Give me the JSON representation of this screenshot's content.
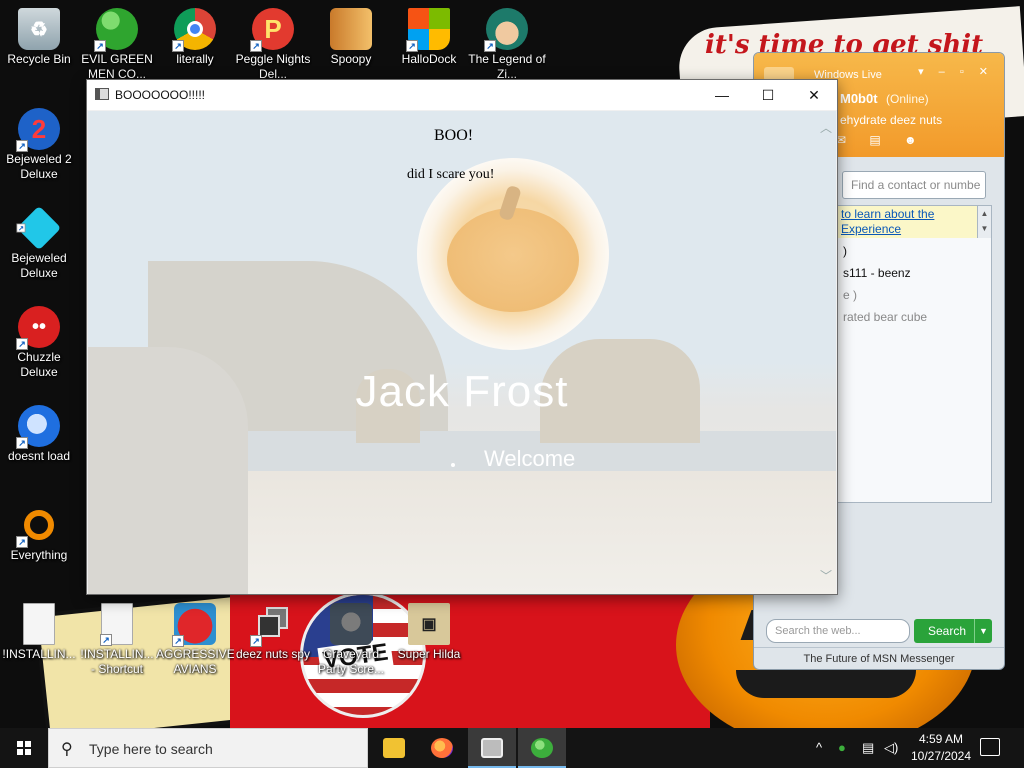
{
  "desktop": {
    "wallpaper_text": "it's time to get shit",
    "wallpaper_vote_text": "VOTE",
    "icons_left": [
      {
        "label": "Recycle Bin",
        "icon": "recycle-bin-icon"
      },
      {
        "label": "Bejeweled 2 Deluxe",
        "icon": "bejeweled-2-icon"
      },
      {
        "label": "Bejeweled Deluxe",
        "icon": "bejeweled-icon"
      },
      {
        "label": "Chuzzle Deluxe",
        "icon": "chuzzle-icon"
      },
      {
        "label": "doesnt load",
        "icon": "thunderbird-icon"
      },
      {
        "label": "Everything",
        "icon": "everything-search-icon"
      },
      {
        "label": "!INSTALLIN...",
        "icon": "document-icon"
      }
    ],
    "icons_top": [
      {
        "label": "EVIL GREEN MEN CO...",
        "icon": "msn-people-icon"
      },
      {
        "label": "literally",
        "icon": "chrome-icon"
      },
      {
        "label": "Peggle Nights Del...",
        "icon": "peggle-icon"
      },
      {
        "label": "Spoopy",
        "icon": "spoopy-icon"
      },
      {
        "label": "HalloDock",
        "icon": "windows-logo-icon"
      },
      {
        "label": "The Legend of Zi...",
        "icon": "legend-character-icon"
      }
    ],
    "icons_bottom": [
      {
        "label": "!INSTALLIN... - Shortcut",
        "icon": "document-shortcut-icon"
      },
      {
        "label": "AGGRESSIVE AVIANS",
        "icon": "angry-bird-icon"
      },
      {
        "label": "deez nuts spy",
        "icon": "stacked-windows-icon"
      },
      {
        "label": "Graveyard Party Scre...",
        "icon": "graveyard-icon"
      },
      {
        "label": "Super Hilda",
        "icon": "pixel-character-icon"
      }
    ]
  },
  "msn": {
    "title": "Windows Live",
    "user_name": "M0b0t",
    "status": "(Online)",
    "personal_message": "ehydrate deez nuts",
    "search_placeholder": "Find a contact or numbe",
    "ad_text": "to learn about the Experience",
    "contacts": [
      ")",
      "s111 - beenz",
      "e )",
      "rated bear cube"
    ],
    "web_search_placeholder": "Search the web...",
    "search_button": "Search",
    "footer": "The Future of MSN Messenger",
    "accent": "#f29a2a"
  },
  "boo_window": {
    "title": "BOOOOOOO!!!!!",
    "heading": "BOO!",
    "body_text": "did I scare you!",
    "login_name": "Jack Frost",
    "login_status": "Welcome",
    "controls": {
      "minimize": "—",
      "maximize": "☐",
      "close": "✕"
    }
  },
  "taskbar": {
    "search_placeholder": "Type here to search",
    "apps": [
      {
        "name": "file-explorer",
        "active": false,
        "color": "#f1c232"
      },
      {
        "name": "firefox",
        "active": false,
        "color": "#ff7139"
      },
      {
        "name": "boo-window",
        "active": true,
        "color": "#bcbcbc"
      },
      {
        "name": "msn-messenger",
        "active": true,
        "color": "#3cae3c"
      }
    ],
    "tray_chevron": "^",
    "time": "4:59 AM",
    "date": "10/27/2024"
  }
}
